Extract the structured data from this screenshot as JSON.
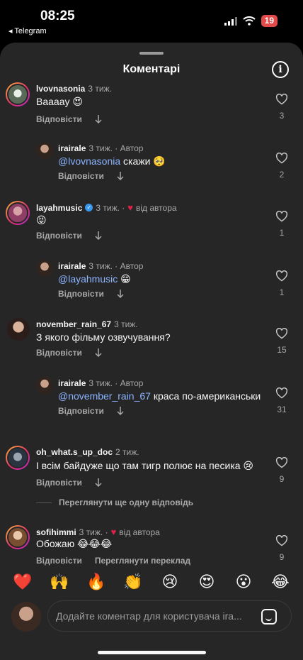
{
  "status_bar": {
    "time": "08:25",
    "back_label": "◂ Telegram",
    "battery": "19"
  },
  "sheet": {
    "title": "Коментарі",
    "info_icon": "info-icon"
  },
  "comments": [
    {
      "username": "lvovnasonia",
      "meta": "3 тиж.",
      "text": "Вааааy 😍",
      "reply": "Відповісти",
      "likes": "3"
    },
    {
      "username": "irairale",
      "meta": "3 тиж. · Автор",
      "mention": "@lvovnasonia",
      "text": " скажи 🥺",
      "reply": "Відповісти",
      "likes": "2"
    },
    {
      "username": "layahmusic",
      "meta": "3 тиж. ·",
      "author_like": "від автора",
      "text": "😝",
      "reply": "Відповісти",
      "likes": "1"
    },
    {
      "username": "irairale",
      "meta": "3 тиж. · Автор",
      "mention": "@layahmusic",
      "text": " 😁",
      "reply": "Відповісти",
      "likes": "1"
    },
    {
      "username": "november_rain_67",
      "meta": "3 тиж.",
      "text": "З якого фільму озвучування?",
      "reply": "Відповісти",
      "likes": "15"
    },
    {
      "username": "irairale",
      "meta": "3 тиж. · Автор",
      "mention": "@november_rain_67",
      "text": " краса по-американськи",
      "reply": "Відповісти",
      "likes": "31"
    },
    {
      "username": "oh_what.s_up_doc",
      "meta": "2 тиж.",
      "text": "І всім байдуже що там тигр полює на песика 😢",
      "reply": "Відповісти",
      "likes": "9"
    },
    {
      "username": "sofihimmi",
      "meta": "3 тиж. ·",
      "author_like": "від автора",
      "text": "Обожаю 😂😂😂",
      "reply": "Відповісти",
      "translate": "Переглянути переклад",
      "likes": "9"
    }
  ],
  "view_more": "Переглянути ще одну відповідь",
  "emoji_bar": [
    "❤️",
    "🙌",
    "🔥",
    "👏",
    "😢",
    "😍",
    "😮",
    "😂"
  ],
  "composer": {
    "placeholder": "Додайте коментар для користувача ira..."
  },
  "colors": {
    "background": "#262626",
    "mention": "#8ab3ff",
    "heart": "#e0224a",
    "battery": "#e34a4a"
  }
}
